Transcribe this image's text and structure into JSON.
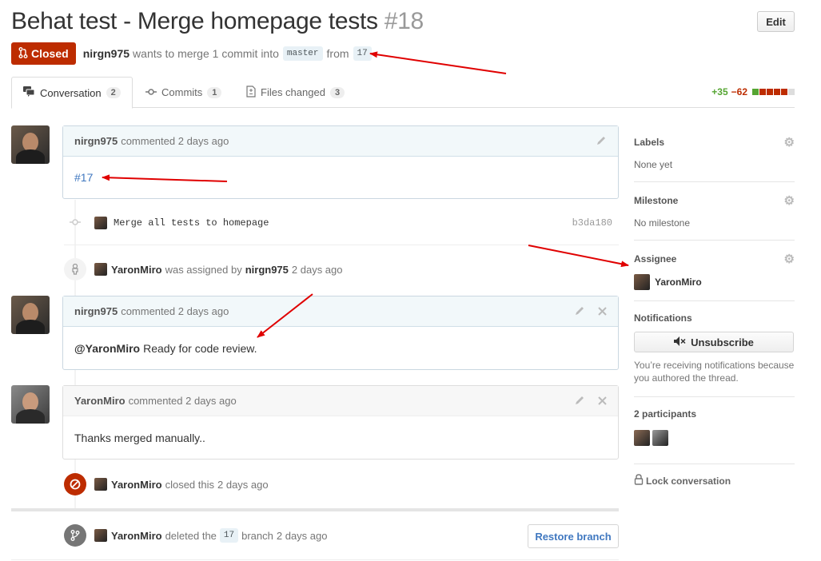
{
  "header": {
    "title": "Behat test - Merge homepage tests",
    "number": "#18",
    "edit_label": "Edit"
  },
  "meta": {
    "state": "Closed",
    "author": "nirgn975",
    "text_wants": "wants to merge 1 commit into",
    "base_branch": "master",
    "text_from": "from",
    "head_branch": "17"
  },
  "tabs": [
    {
      "label": "Conversation",
      "count": "2"
    },
    {
      "label": "Commits",
      "count": "1"
    },
    {
      "label": "Files changed",
      "count": "3"
    }
  ],
  "diffstat": {
    "additions": "+35",
    "deletions": "−62",
    "blocks": [
      "#55a532",
      "#bd2c00",
      "#bd2c00",
      "#bd2c00",
      "#bd2c00",
      "#dddddd"
    ]
  },
  "comments": [
    {
      "author": "nirgn975",
      "action": "commented",
      "time": "2 days ago",
      "body_mention": "",
      "body": "#17"
    },
    {
      "author": "nirgn975",
      "action": "commented",
      "time": "2 days ago",
      "body_mention": "@YaronMiro",
      "body": "Ready for code review."
    },
    {
      "author": "YaronMiro",
      "action": "commented",
      "time": "2 days ago",
      "body_mention": "",
      "body": "Thanks merged manually.."
    }
  ],
  "commit": {
    "message": "Merge all tests to homepage",
    "sha": "b3da180"
  },
  "events": {
    "assigned": {
      "actor": "YaronMiro",
      "text": "was assigned by",
      "by": "nirgn975",
      "time": "2 days ago"
    },
    "closed": {
      "actor": "YaronMiro",
      "text": "closed this",
      "time": "2 days ago"
    },
    "deleted": {
      "actor": "YaronMiro",
      "text": "deleted the",
      "branch": "17",
      "text2": "branch",
      "time": "2 days ago",
      "restore_label": "Restore branch"
    }
  },
  "sidebar": {
    "labels": {
      "title": "Labels",
      "value": "None yet"
    },
    "milestone": {
      "title": "Milestone",
      "value": "No milestone"
    },
    "assignee": {
      "title": "Assignee",
      "value": "YaronMiro"
    },
    "notifications": {
      "title": "Notifications",
      "button": "Unsubscribe",
      "reason": "You’re receiving notifications because you authored the thread."
    },
    "participants": {
      "title": "2 participants"
    },
    "lock": "Lock conversation"
  },
  "colors": {
    "closed": "#bd2c00",
    "link": "#4078c0",
    "annotation_arrow": "#e00000"
  },
  "icons": [
    "pull-request-icon",
    "comment-icon",
    "commit-icon",
    "file-diff-icon",
    "pencil-icon",
    "close-icon",
    "person-icon",
    "blocked-icon",
    "git-branch-icon",
    "gear-icon",
    "mute-icon",
    "lock-icon"
  ]
}
